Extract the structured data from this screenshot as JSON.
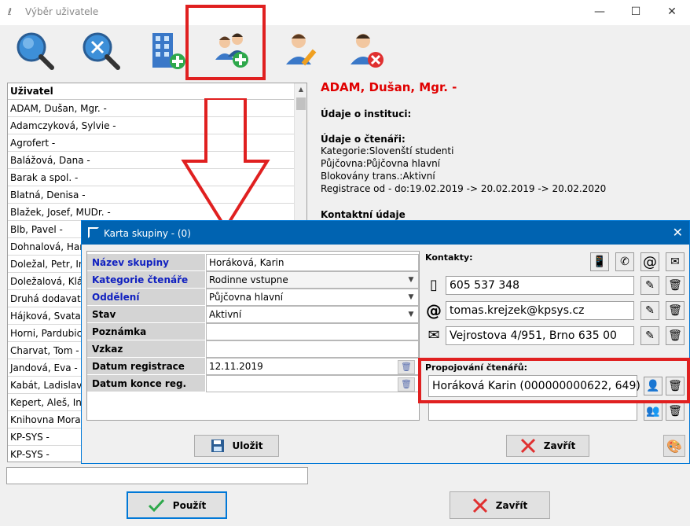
{
  "window": {
    "title": "Výběr uživatele"
  },
  "user_list": {
    "header": "Uživatel",
    "rows": [
      "ADAM, Dušan, Mgr. -",
      "Adamczyková, Sylvie -",
      "Agrofert -",
      "Balážová, Dana -",
      "Barak a spol. -",
      "Blatná, Denisa -",
      "Blažek, Josef, MUDr. -",
      "Blb, Pavel -",
      "Dohnalová, Hana",
      "Doležal, Petr, Ing.",
      "Doležalová, Klára",
      "Druhá dodavatel",
      "Hájková, Svatava",
      "Horni, Pardubice",
      "Charvat, Tom -",
      "Jandová, Eva -",
      "Kabát, Ladislav,",
      "Kepert, Aleš, Ing.",
      "Knihovna Morav",
      "KP-SYS -",
      "KP-SYS -"
    ]
  },
  "buttons": {
    "use": "Použít",
    "close": "Zavřít"
  },
  "detail": {
    "name": "ADAM, Dušan, Mgr. -",
    "institution_heading": "Údaje o instituci:",
    "reader_heading": "Údaje o čtenáři:",
    "reader_lines": [
      "Kategorie:Slovenští studenti",
      "Půjčovna:Půjčovna hlavní",
      "Blokovány trans.:Aktivní",
      "Registrace od - do:19.02.2019 -> 20.02.2019 -> 20.02.2020"
    ],
    "contact_heading": "Kontaktní údaje"
  },
  "dialog": {
    "title": "Karta skupiny -  (0)",
    "fields": {
      "name_label": "Název skupiny",
      "name_value": "Horáková, Karin",
      "category_label": "Kategorie čtenáře",
      "category_value": "Rodinne vstupne",
      "dept_label": "Oddělení",
      "dept_value": "Půjčovna hlavní",
      "state_label": "Stav",
      "state_value": "Aktivní",
      "note_label": "Poznámka",
      "note_value": "",
      "message_label": "Vzkaz",
      "message_value": "",
      "reg_date_label": "Datum registrace",
      "reg_date_value": "12.11.2019",
      "reg_end_label": "Datum konce reg.",
      "reg_end_value": ""
    },
    "contacts_label": "Kontakty:",
    "phone": "605 537 348",
    "email": "tomas.krejzek@kpsys.cz",
    "address": "Vejrostova 4/951, Brno 635 00",
    "linking_label": "Propojování čtenářů:",
    "linked_reader": "Horáková  Karin (000000000622, 649)",
    "save_label": "Uložit",
    "close_label": "Zavřít"
  },
  "colors": {
    "highlight": "#e02020",
    "title_bar": "#0063b1",
    "detail_name": "#e00000",
    "field_label_blue": "#1020c0"
  }
}
